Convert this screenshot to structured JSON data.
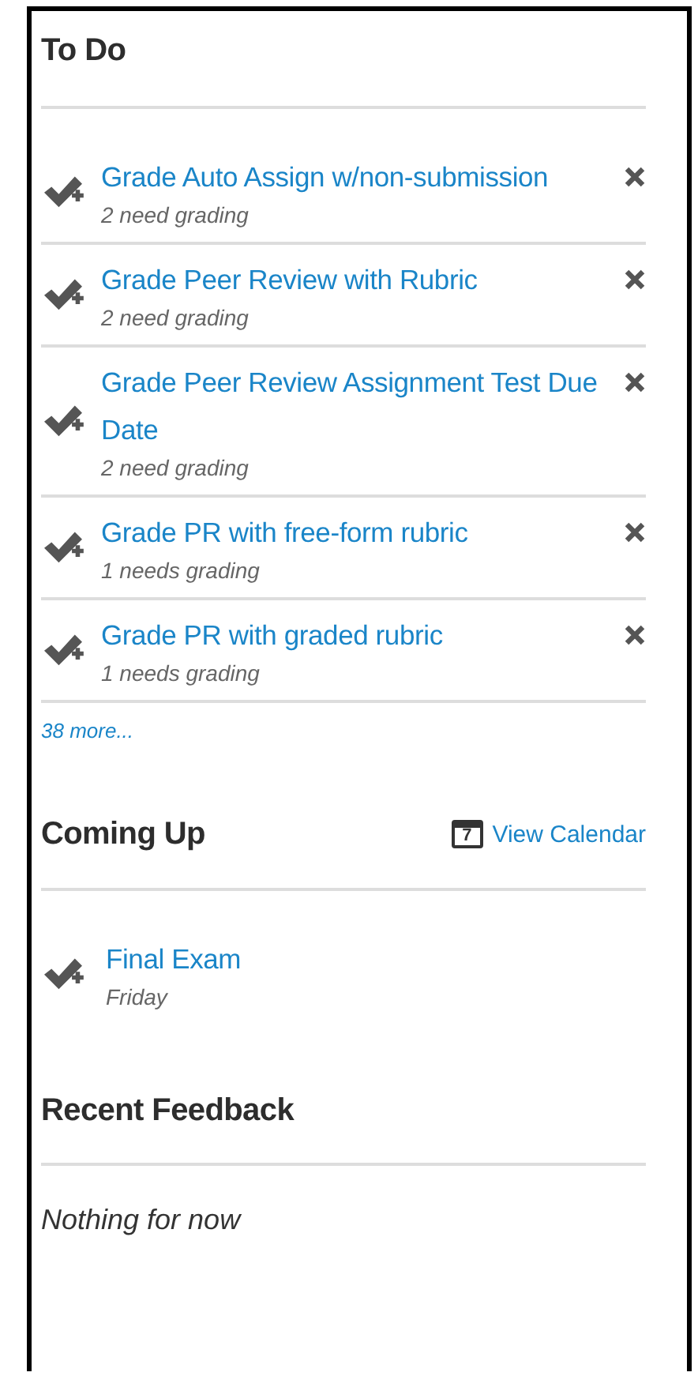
{
  "todo": {
    "title": "To Do",
    "items": [
      {
        "title": "Grade Auto Assign w/non-submission",
        "subtitle": "2 need grading"
      },
      {
        "title": "Grade Peer Review with Rubric",
        "subtitle": "2 need grading"
      },
      {
        "title": "Grade Peer Review Assignment Test Due Date",
        "subtitle": "2 need grading"
      },
      {
        "title": "Grade PR with free-form rubric",
        "subtitle": "1 needs grading"
      },
      {
        "title": "Grade PR with graded rubric",
        "subtitle": "1 needs grading"
      }
    ],
    "more": "38 more..."
  },
  "coming_up": {
    "title": "Coming Up",
    "calendar_day": "7",
    "calendar_link": "View Calendar",
    "items": [
      {
        "title": "Final Exam",
        "subtitle": "Friday"
      }
    ]
  },
  "recent_feedback": {
    "title": "Recent Feedback",
    "empty": "Nothing for now"
  }
}
